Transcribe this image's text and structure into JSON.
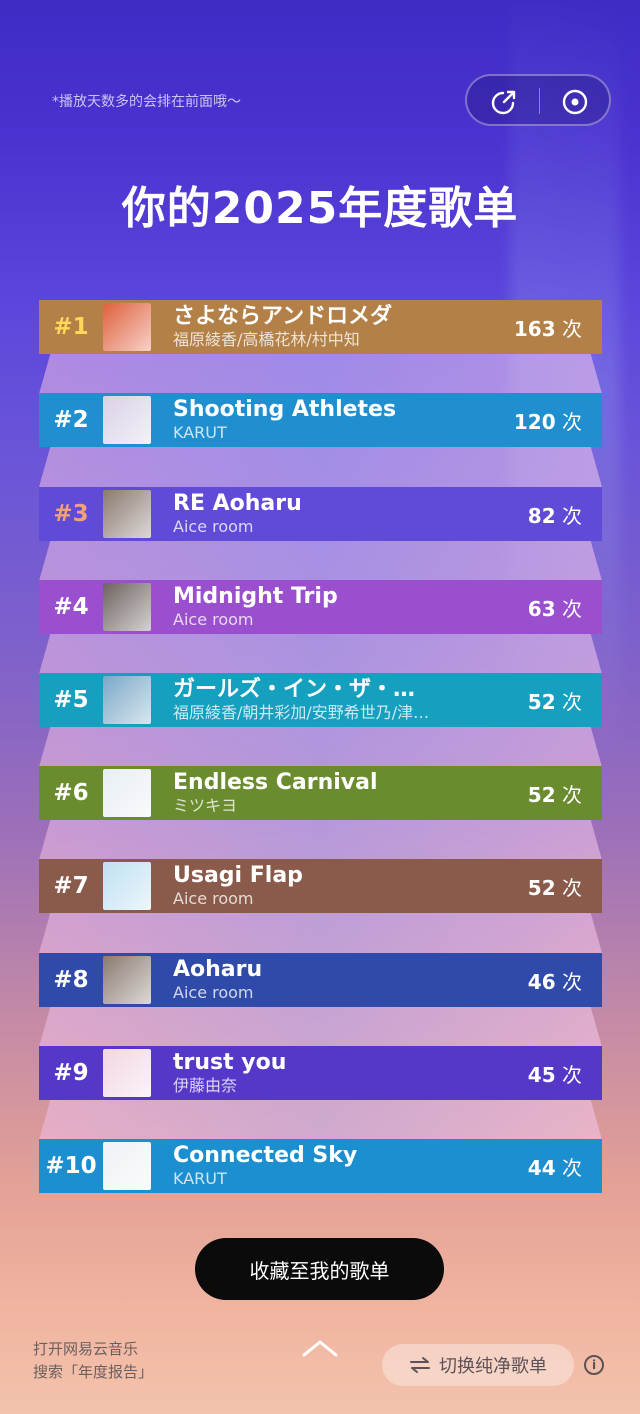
{
  "header": {
    "hint": "*播放天数多的会排在前面哦～",
    "share_icon": "share-icon",
    "record_icon": "record-icon"
  },
  "title": "你的2025年度歌单",
  "songs": [
    {
      "rank": "#1",
      "title": "さよならアンドロメダ",
      "artist": "福原綾香/高橋花林/村中知",
      "count": "163",
      "unit": "次",
      "color": "#b38048",
      "rank_color": "#ffd75a",
      "thumb": "#e0603d"
    },
    {
      "rank": "#2",
      "title": "Shooting Athletes",
      "artist": "KARUT",
      "count": "120",
      "unit": "次",
      "color": "#1f8fcf",
      "rank_color": "#ffffff",
      "thumb": "#d9d0e6"
    },
    {
      "rank": "#3",
      "title": "RE Aoharu",
      "artist": "Aice room",
      "count": "82",
      "unit": "次",
      "color": "#5f4bd8",
      "rank_color": "#f4a07a",
      "thumb": "#8a7a70"
    },
    {
      "rank": "#4",
      "title": "Midnight Trip",
      "artist": "Aice room",
      "count": "63",
      "unit": "次",
      "color": "#9a4fcf",
      "rank_color": "#ffffff",
      "thumb": "#6d6260"
    },
    {
      "rank": "#5",
      "title": "ガールズ・イン・ザ・…",
      "artist": "福原綾香/朝井彩加/安野希世乃/津…",
      "count": "52",
      "unit": "次",
      "color": "#16a0c0",
      "rank_color": "#ffffff",
      "thumb": "#7aa8c8"
    },
    {
      "rank": "#6",
      "title": "Endless Carnival",
      "artist": "ミツキヨ",
      "count": "52",
      "unit": "次",
      "color": "#6a8c2e",
      "rank_color": "#ffffff",
      "thumb": "#e8eef4"
    },
    {
      "rank": "#7",
      "title": "Usagi Flap",
      "artist": "Aice room",
      "count": "52",
      "unit": "次",
      "color": "#8a5a4a",
      "rank_color": "#ffffff",
      "thumb": "#bfe0f2"
    },
    {
      "rank": "#8",
      "title": "Aoharu",
      "artist": "Aice room",
      "count": "46",
      "unit": "次",
      "color": "#2f4aa8",
      "rank_color": "#ffffff",
      "thumb": "#8a7a70"
    },
    {
      "rank": "#9",
      "title": "trust you",
      "artist": "伊藤由奈",
      "count": "45",
      "unit": "次",
      "color": "#5638c8",
      "rank_color": "#ffffff",
      "thumb": "#f2d6e4"
    },
    {
      "rank": "#10",
      "title": "Connected Sky",
      "artist": "KARUT",
      "count": "44",
      "unit": "次",
      "color": "#1b8fd0",
      "rank_color": "#ffffff",
      "thumb": "#eef2f6"
    }
  ],
  "actions": {
    "save_label": "收藏至我的歌单",
    "switch_label": "切换纯净歌单",
    "info_label": "i"
  },
  "footer": {
    "line1": "打开网易云音乐",
    "line2": "搜索「年度报告」"
  }
}
